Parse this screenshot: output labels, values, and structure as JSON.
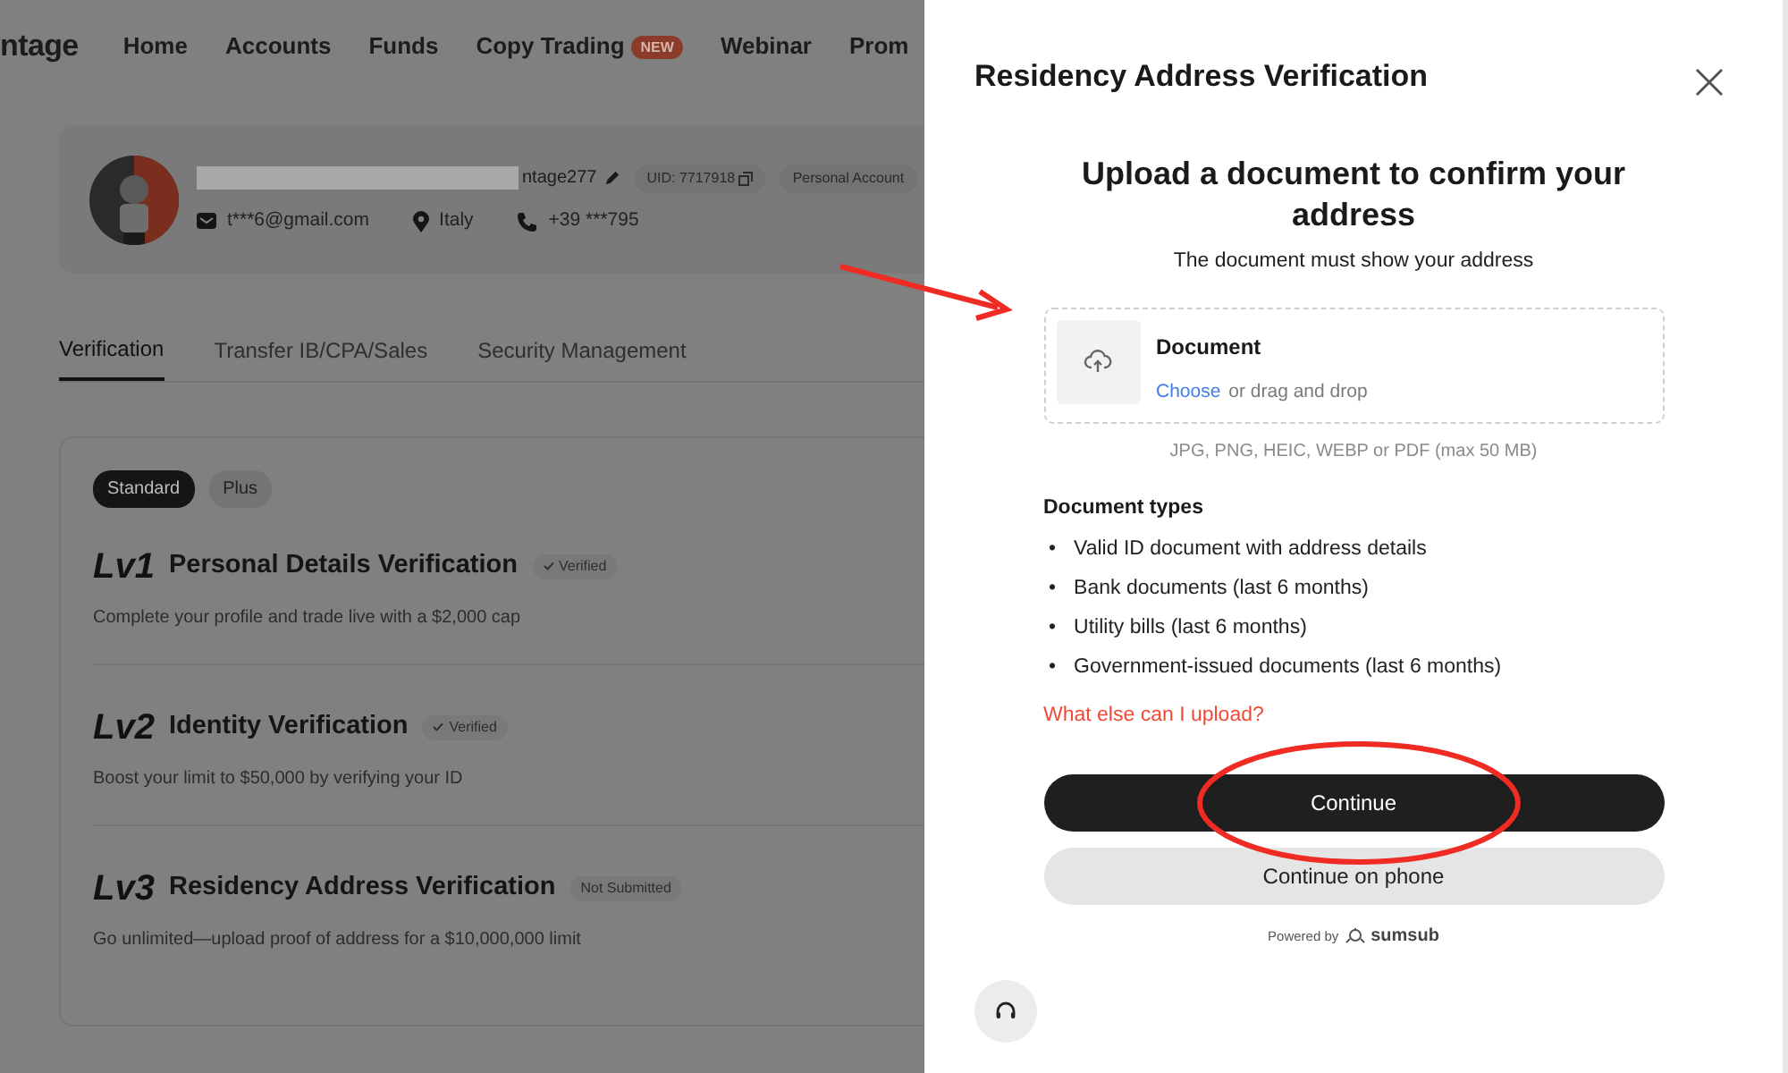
{
  "background": {
    "logo": "ntage",
    "nav": [
      {
        "label": "Home"
      },
      {
        "label": "Accounts"
      },
      {
        "label": "Funds"
      },
      {
        "label": "Copy Trading",
        "badge": "NEW"
      },
      {
        "label": "Webinar"
      },
      {
        "label": "Prom"
      }
    ],
    "profile": {
      "name": "ntage277",
      "uid": "UID: 7717918",
      "account_type": "Personal Account",
      "email": "t***6@gmail.com",
      "country": "Italy",
      "phone": "+39 ***795"
    },
    "tabs": [
      {
        "label": "Verification",
        "selected": true
      },
      {
        "label": "Transfer IB/CPA/Sales",
        "selected": false
      },
      {
        "label": "Security Management",
        "selected": false
      }
    ],
    "plan_tabs": [
      {
        "label": "Standard",
        "selected": true
      },
      {
        "label": "Plus",
        "selected": false
      }
    ],
    "levels": [
      {
        "level": "Lv1",
        "title": "Personal Details Verification",
        "status": "Verified",
        "verified": true,
        "description": "Complete your profile and trade live with a $2,000 cap"
      },
      {
        "level": "Lv2",
        "title": "Identity Verification",
        "status": "Verified",
        "verified": true,
        "description": "Boost your limit to $50,000 by verifying your ID"
      },
      {
        "level": "Lv3",
        "title": "Residency Address Verification",
        "status": "Not Submitted",
        "verified": false,
        "description": "Go unlimited—upload proof of address for a $10,000,000 limit"
      }
    ]
  },
  "panel": {
    "title": "Residency Address Verification",
    "heading": "Upload a document to confirm your address",
    "subtitle": "The document must show your address",
    "upload": {
      "label": "Document",
      "link": "Choose",
      "hint": "or drag and drop"
    },
    "formats": "JPG, PNG, HEIC, WEBP or PDF (max 50 MB)",
    "doc_types_title": "Document types",
    "bullet": "•",
    "doc_types": [
      "Valid ID document with address details",
      "Bank documents (last 6 months)",
      "Utility bills (last 6 months)",
      "Government-issued documents (last 6 months)"
    ],
    "help_link": "What else can I upload?",
    "buttons": [
      {
        "label": "Continue",
        "kind": "primary"
      },
      {
        "label": "Continue on phone",
        "kind": "secondary"
      }
    ],
    "powered_by": "Powered by",
    "brand": "sumsub"
  }
}
